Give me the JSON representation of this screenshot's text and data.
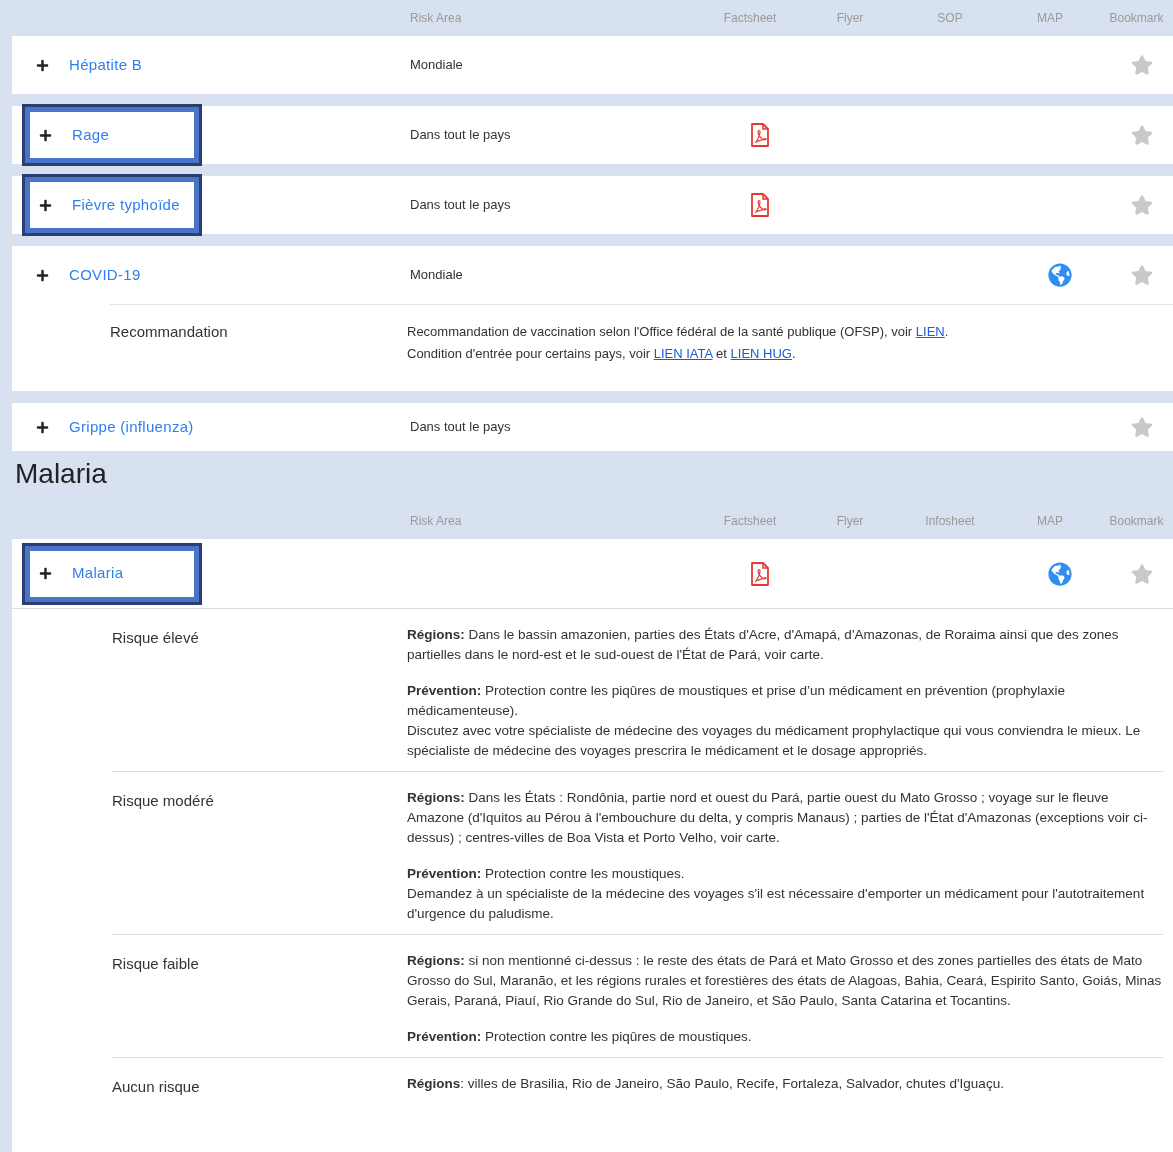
{
  "vaccines": {
    "columns": [
      "Risk Area",
      "Factsheet",
      "Flyer",
      "SOP",
      "MAP",
      "Bookmark"
    ],
    "rows": [
      {
        "name": "Hépatite B",
        "risk_area": "Mondiale",
        "factsheet": false,
        "map": false,
        "bookmarked": false,
        "highlighted": false
      },
      {
        "name": "Rage",
        "risk_area": "Dans tout le pays",
        "factsheet": true,
        "map": false,
        "bookmarked": false,
        "highlighted": true
      },
      {
        "name": "Fièvre typhoïde",
        "risk_area": "Dans tout le pays",
        "factsheet": true,
        "map": false,
        "bookmarked": false,
        "highlighted": true
      },
      {
        "name": "COVID-19",
        "risk_area": "Mondiale",
        "factsheet": false,
        "map": true,
        "bookmarked": false,
        "highlighted": false,
        "details": [
          {
            "label": "Recommandation",
            "lines": [
              [
                {
                  "kind": "text",
                  "text": "Recommandation de vaccination selon l'Office fédéral de la santé publique (OFSP), voir "
                },
                {
                  "kind": "link",
                  "text": "LIEN"
                },
                {
                  "kind": "text",
                  "text": "."
                }
              ],
              [
                {
                  "kind": "text",
                  "text": "Condition d'entrée pour certains pays, voir "
                },
                {
                  "kind": "link",
                  "text": "LIEN IATA"
                },
                {
                  "kind": "text",
                  "text": " et "
                },
                {
                  "kind": "link",
                  "text": "LIEN HUG"
                },
                {
                  "kind": "text",
                  "text": "."
                }
              ]
            ]
          }
        ]
      },
      {
        "name": "Grippe (influenza)",
        "risk_area": "Dans tout le pays",
        "factsheet": false,
        "map": false,
        "bookmarked": false,
        "highlighted": false
      }
    ]
  },
  "malaria": {
    "title": "Malaria",
    "columns": [
      "Risk Area",
      "Factsheet",
      "Flyer",
      "Infosheet",
      "MAP",
      "Bookmark"
    ],
    "rows": [
      {
        "name": "Malaria",
        "risk_area": "",
        "factsheet": true,
        "map": true,
        "bookmarked": false,
        "highlighted": true,
        "details": [
          {
            "label": "Risque élevé",
            "paragraphs": [
              "**Régions:** Dans le bassin amazonien, parties des États d'Acre, d'Amapá, d'Amazonas, de Roraima ainsi que des zones partielles dans le nord-est et le sud-ouest de l'État de Pará, voir carte.",
              "**Prévention:** Protection contre les piqûres de moustiques et prise d’un médicament en prévention (prophylaxie médicamenteuse).\nDiscutez avec votre spécialiste de médecine des voyages du médicament prophylactique qui vous conviendra le mieux. Le spécialiste de médecine des voyages prescrira le médicament et le dosage appropriés."
            ]
          },
          {
            "label": "Risque modéré",
            "paragraphs": [
              "**Régions:** Dans les États : Rondônia, partie nord et ouest du Pará, partie ouest du Mato Grosso ; voyage sur le fleuve Amazone (d'Iquitos au Pérou à l'embouchure du delta, y compris Manaus) ; parties de l'État d'Amazonas (exceptions voir ci-dessus) ; centres-villes de Boa Vista et Porto Velho, voir carte.",
              "**Prévention:** Protection contre les moustiques.\nDemandez à un spécialiste de la médecine des voyages s'il est nécessaire d'emporter un médicament pour l'autotraitement d'urgence du paludisme."
            ]
          },
          {
            "label": "Risque faible",
            "paragraphs": [
              "**Régions:** si non mentionné ci-dessus : le reste des états de Pará et Mato Grosso et des zones partielles des états de Mato Grosso do Sul, Maranão, et les régions rurales et forestières des états de Alagoas, Bahia, Ceará, Espirito Santo, Goiás, Minas Gerais, Paraná, Piauí, Rio Grande do Sul, Rio de Janeiro, et São Paulo, Santa Catarina et Tocantins.",
              "**Prévention:** Protection contre les piqûres de moustiques."
            ]
          },
          {
            "label": "Aucun risque",
            "paragraphs": [
              "**Régions**: villes de Brasilia, Rio de Janeiro, São Paulo, Recife, Fortaleza, Salvador, chutes d'Iguaçu."
            ]
          }
        ]
      }
    ]
  }
}
